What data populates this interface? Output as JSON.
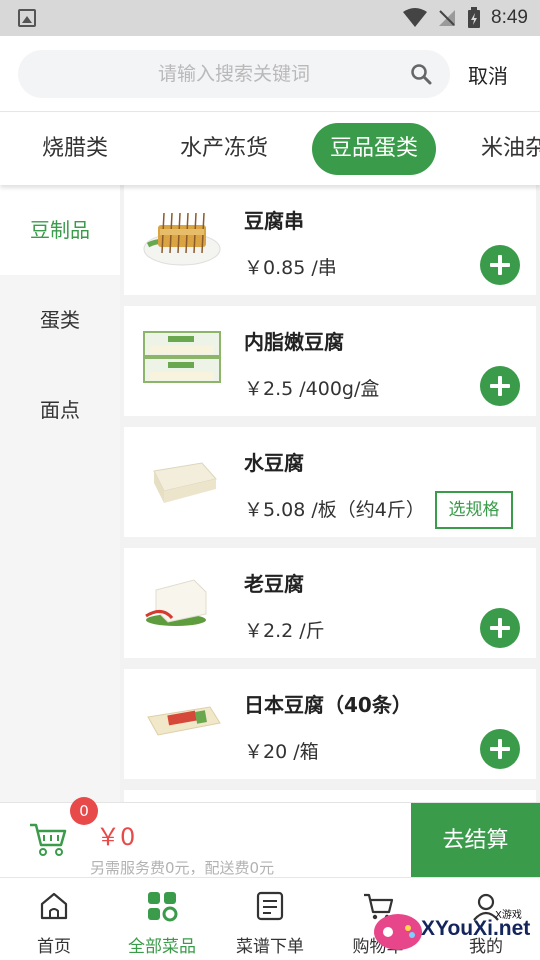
{
  "status_bar": {
    "time": "8:49"
  },
  "search": {
    "placeholder": "请输入搜索关键词",
    "cancel_label": "取消"
  },
  "categories": [
    {
      "label": "烧腊类",
      "active": false
    },
    {
      "label": "水产冻货",
      "active": false
    },
    {
      "label": "豆品蛋类",
      "active": true
    },
    {
      "label": "米油杂",
      "active": false
    }
  ],
  "sidebar": {
    "items": [
      {
        "label": "豆制品",
        "active": true
      },
      {
        "label": "蛋类",
        "active": false
      },
      {
        "label": "面点",
        "active": false
      }
    ]
  },
  "products": [
    {
      "name": "豆腐串",
      "price": "￥0.85 /串",
      "action": "add"
    },
    {
      "name": "内脂嫩豆腐",
      "price": "￥2.5 /400g/盒",
      "action": "add"
    },
    {
      "name": "水豆腐",
      "price": "￥5.08 /板（约4斤）",
      "action": "spec",
      "spec_label": "选规格"
    },
    {
      "name": "老豆腐",
      "price": "￥2.2 /斤",
      "action": "add"
    },
    {
      "name": "日本豆腐（40条）",
      "price": "￥20 /箱",
      "action": "add"
    }
  ],
  "cart": {
    "count": "0",
    "total": "￥0",
    "fee_note": "另需服务费0元，配送费0元",
    "checkout_label": "去结算"
  },
  "bottom_nav": {
    "items": [
      {
        "label": "首页",
        "icon": "home-icon",
        "active": false
      },
      {
        "label": "全部菜品",
        "icon": "grid-icon",
        "active": true
      },
      {
        "label": "菜谱下单",
        "icon": "recipe-icon",
        "active": false
      },
      {
        "label": "购物车",
        "icon": "cart-icon",
        "active": false
      },
      {
        "label": "我的",
        "icon": "user-icon",
        "active": false
      }
    ]
  },
  "watermark": {
    "small": "X游戏",
    "text": "XYouXi.net"
  },
  "colors": {
    "accent": "#3a9b4a",
    "price_red": "#e84a4a",
    "status_bar": "#d8d8d8"
  }
}
